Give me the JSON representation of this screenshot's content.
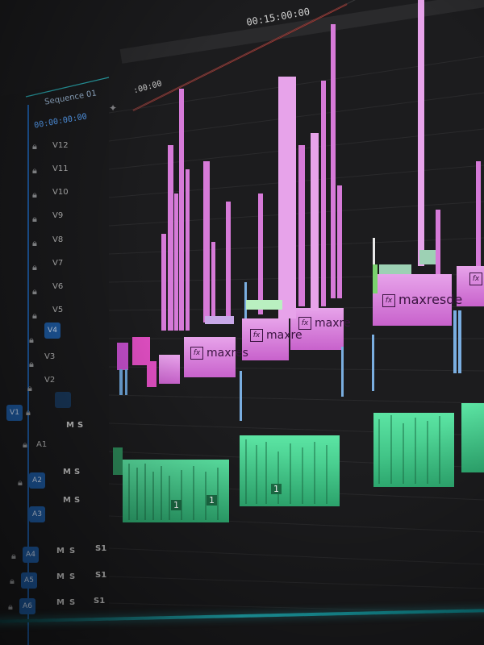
{
  "app": {
    "sequence_tab": "Sequence 01",
    "playhead_timecode": "00:00:00:00",
    "ruler": {
      "start": ":00:00",
      "marker": "00:15:00:00"
    }
  },
  "video_tracks": [
    {
      "name": "V12"
    },
    {
      "name": "V11"
    },
    {
      "name": "V10"
    },
    {
      "name": "V9"
    },
    {
      "name": "V8"
    },
    {
      "name": "V7"
    },
    {
      "name": "V6"
    },
    {
      "name": "V5"
    },
    {
      "name": "V4"
    },
    {
      "name": "V3"
    },
    {
      "name": "V2"
    },
    {
      "name": "V1"
    }
  ],
  "audio_tracks": [
    {
      "name": "A1",
      "m": "M",
      "s": "S"
    },
    {
      "name": "A2",
      "m": "M",
      "s": "S"
    },
    {
      "name": "A3",
      "m": "M",
      "s": "S"
    },
    {
      "name": "A4",
      "m": "M",
      "s": "S",
      "extra": "S1"
    },
    {
      "name": "A5",
      "m": "M",
      "s": "S",
      "extra": "S1"
    },
    {
      "name": "A6",
      "m": "M",
      "s": "S",
      "extra": "S1"
    }
  ],
  "clips": {
    "maxres1": "maxres",
    "maxres2": "maxre",
    "maxres3": "maxre",
    "maxres4": "maxresde",
    "fx": "fx",
    "audio_num": "1"
  },
  "colors": {
    "video_clip": "#d67ad8",
    "video_clip_light": "#e7a3ea",
    "audio_clip": "#41c98a",
    "accent_blue": "#1f5ea8",
    "ruler_red": "#c8322a"
  }
}
